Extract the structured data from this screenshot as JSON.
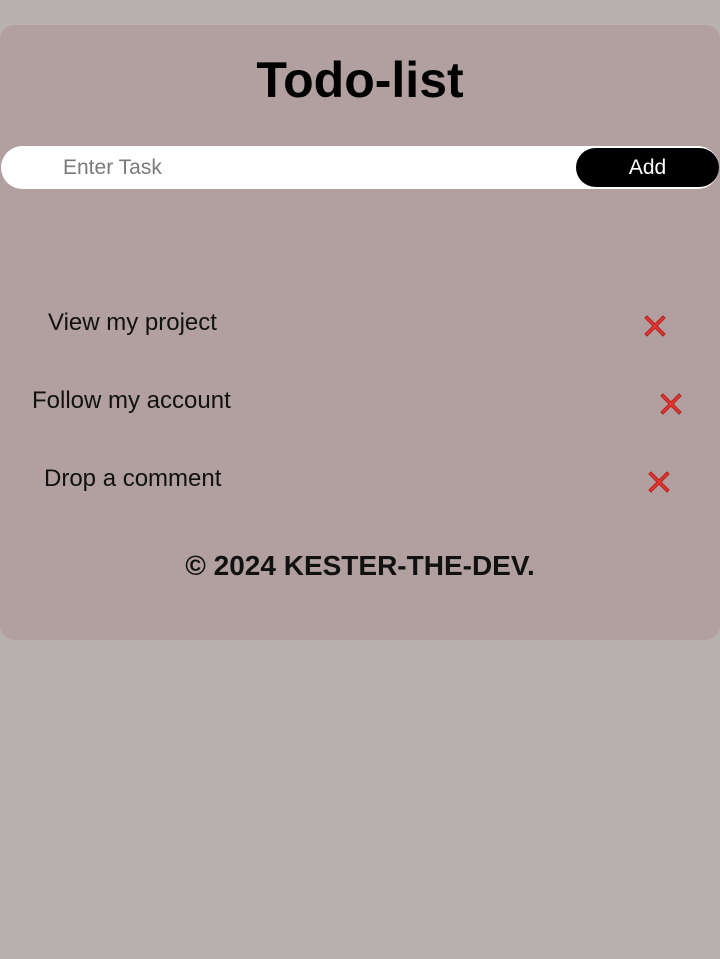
{
  "header": {
    "title": "Todo-list"
  },
  "task_form": {
    "placeholder": "Enter Task",
    "value": "",
    "add_label": "Add"
  },
  "todos": [
    {
      "text": "View my project",
      "delete_icon": "red-x-icon"
    },
    {
      "text": "Follow my account",
      "delete_icon": "red-x-icon"
    },
    {
      "text": "Drop a comment",
      "delete_icon": "red-x-icon"
    }
  ],
  "footer": {
    "copyright": "© 2024 KESTER-THE-DEV."
  },
  "colors": {
    "page_background": "#b9b0b1",
    "card_background": "#b1a09f",
    "button_background": "#000000",
    "delete_icon": "#e53935"
  }
}
